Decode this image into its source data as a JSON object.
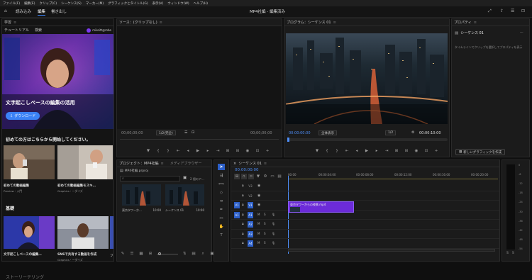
{
  "menubar": [
    "ファイル(F)",
    "編集(E)",
    "クリップ(C)",
    "シーケンス(S)",
    "マーカー(M)",
    "グラフィックとタイトル(G)",
    "表示(V)",
    "ウィンドウ(W)",
    "ヘルプ(H)"
  ],
  "topbar": {
    "tabs": [
      "読み込み",
      "編集",
      "書き出し"
    ],
    "active_tab": "編集",
    "title": "MP4社編 - 編集済み"
  },
  "learn": {
    "tab_title": "学習",
    "sub_tabs": [
      "チュートリアル",
      "検索"
    ],
    "user": "mikeitt@mbe",
    "hero_title": "文字起こしベースの編集の活用",
    "download_label": "ダウンロード",
    "section1_title": "初めての方はこちらから開始してください。",
    "cards1": [
      {
        "title": "初めての動画編集",
        "sub": "Preview・入門"
      },
      {
        "title": "初めての動画編集モスキ…",
        "sub": "Graphics・ーダイズ"
      }
    ],
    "section2_title": "基礎",
    "cards2": [
      {
        "title": "文字起こしベースの編集…",
        "sub": ""
      },
      {
        "title": "SNSで共有する動画を作成",
        "sub": "Graphics・ーダイズ"
      },
      {
        "title": "フ",
        "sub": ""
      }
    ],
    "footer_text": "ストーリーテリング"
  },
  "source": {
    "tab_title": "ソース：(クリップなし)",
    "tc_left": "00;00;00;00",
    "tc_right": "00;00;00;00",
    "zoom": "1/2(完全)"
  },
  "program": {
    "tab_title": "プログラム：シーケンス 01",
    "tc_left": "00:00:00:00",
    "fit": "全体表示",
    "quality": "1/2",
    "tc_right": "00:00:10:00"
  },
  "properties": {
    "tab_title": "プロパティ",
    "sequence_name": "シーケンス 01",
    "hint": "タイムラインでクリップを選択してプロパティを表示",
    "new_graphic": "新しいグラフィックを作成"
  },
  "project": {
    "tab_title": "プロジェクト：MP4社編",
    "tab2": "メディアブラウザー",
    "project_file": "MP4社編.prproj",
    "item_count": "2 個のア…",
    "items": [
      {
        "name": "東京タワーか…",
        "duration": "10:00"
      },
      {
        "name": "シーケンス 01",
        "duration": "10:00"
      }
    ]
  },
  "timeline": {
    "tab_title": "シーケンス 01",
    "timecode": "00:00:00:00",
    "ruler": [
      "00:00",
      "00:00:04:00",
      "00:00:08:00",
      "00:00:12:00",
      "00:00:16:00",
      "00:00:20:00"
    ],
    "tracks": [
      "V3",
      "V2",
      "V1",
      "A1",
      "A2",
      "A3",
      "A4"
    ],
    "clip_label": "東京タワーからの夜景.mp4",
    "clip_fraction": 0.32
  },
  "meter": {
    "scale": [
      "0",
      "-6",
      "-12",
      "-18",
      "-24",
      "-30",
      "-36",
      "-42",
      "-48",
      "-54"
    ],
    "labels": [
      "S",
      "S"
    ]
  },
  "colors": {
    "accent": "#3b82f6",
    "clip": "#6c2bd9",
    "timecode": "#4d8df6"
  }
}
